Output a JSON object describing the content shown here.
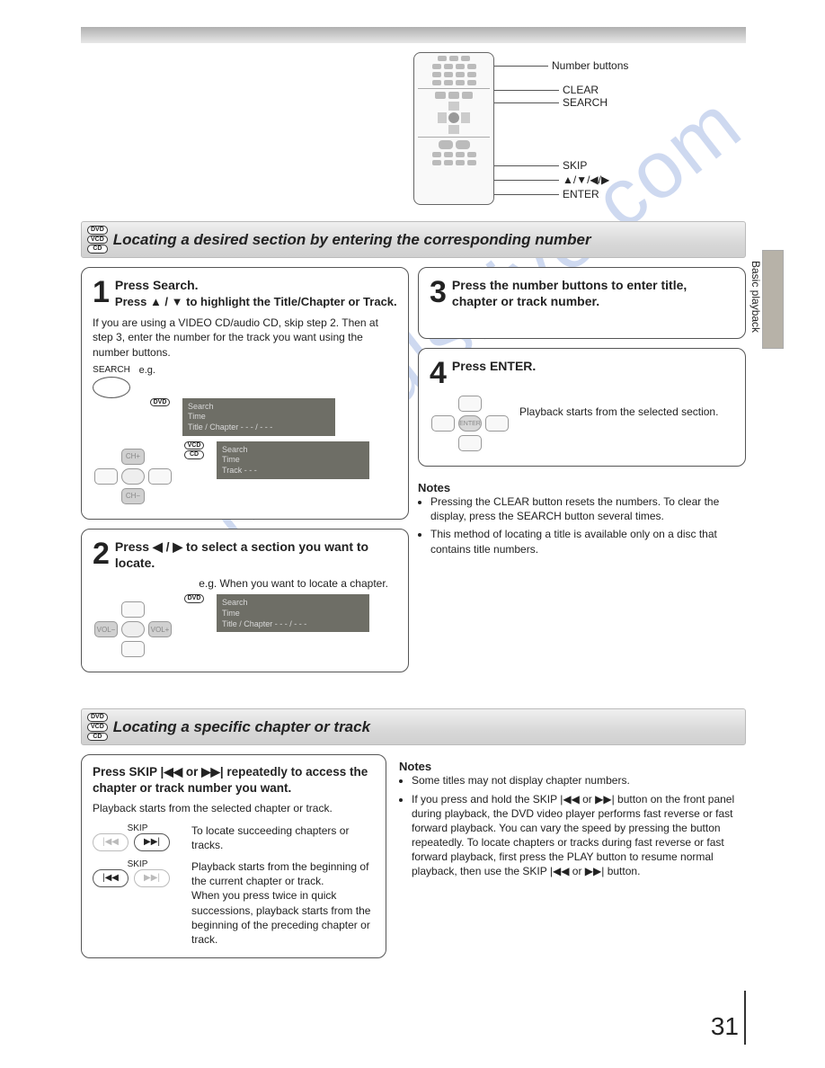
{
  "remote_callouts": {
    "number_buttons": "Number buttons",
    "clear": "CLEAR",
    "search": "SEARCH",
    "skip": "SKIP",
    "arrows": "▲/▼/◀/▶",
    "enter": "ENTER"
  },
  "side_tab_label": "Basic playback",
  "section1": {
    "discs": [
      "DVD",
      "VCD",
      "CD"
    ],
    "heading": "Locating a desired section by entering the corresponding number",
    "step1": {
      "title": "Press Search.",
      "subtitle": "Press ▲ / ▼ to highlight the Title/Chapter or Track.",
      "body": "If you are using a VIDEO CD/audio CD, skip step 2. Then at step 3, enter the number for the track you want using the number buttons.",
      "search_label": "SEARCH",
      "eg": "e.g.",
      "osd1_disc": "DVD",
      "osd1_lines": [
        "Search",
        "Time",
        "Title / Chapter   - - - / - - -"
      ],
      "osd2_discs": [
        "VCD",
        "CD"
      ],
      "osd2_lines": [
        "Search",
        "Time",
        "Track                - - -"
      ],
      "dpad": {
        "up": "CH+",
        "down": "CH−",
        "left": "",
        "right": "",
        "center": ""
      }
    },
    "step2": {
      "title": "Press ◀ / ▶ to select a section you want to locate.",
      "eg": "e.g. When you want to locate a chapter.",
      "osd_disc": "DVD",
      "osd_lines": [
        "Search",
        "Time",
        "Title / Chapter   - - - / - - -"
      ],
      "dpad": {
        "left": "VOL−",
        "right": "VOL+",
        "up": "",
        "down": "",
        "center": ""
      }
    },
    "step3": {
      "title": "Press the number buttons to enter title, chapter or track number."
    },
    "step4": {
      "title": "Press ENTER.",
      "body": "Playback starts from the selected section.",
      "dpad": {
        "center": "ENTER",
        "up": "",
        "down": "",
        "left": "",
        "right": ""
      }
    },
    "notes_title": "Notes",
    "notes": [
      "Pressing the CLEAR button resets the numbers. To clear the display, press the SEARCH button several times.",
      "This method of locating a title is available only on a disc that contains title numbers."
    ]
  },
  "section2": {
    "discs": [
      "DVD",
      "VCD",
      "CD"
    ],
    "heading": "Locating a specific chapter or track",
    "box": {
      "title": "Press SKIP |◀◀ or ▶▶| repeatedly to access the chapter or track number you want.",
      "body": "Playback starts from the selected chapter or track.",
      "skip_label": "SKIP",
      "fwd_text": "To locate succeeding chapters or tracks.",
      "back_text": "Playback starts from the beginning of the current chapter or track.\nWhen you press twice in quick successions, playback starts from the beginning of the preceding chapter or track.",
      "btn_back": "|◀◀",
      "btn_fwd": "▶▶|"
    },
    "notes_title": "Notes",
    "notes": [
      "Some titles may not display chapter numbers.",
      "If you press and hold the SKIP |◀◀ or ▶▶| button on the front panel during playback, the DVD video player performs fast reverse or fast forward playback. You can vary the speed by pressing the button repeatedly. To locate chapters or tracks during fast reverse or fast forward playback, first press the PLAY button to resume normal playback, then use the SKIP |◀◀ or ▶▶| button."
    ]
  },
  "page_number": "31",
  "watermark": "manualshive.com"
}
